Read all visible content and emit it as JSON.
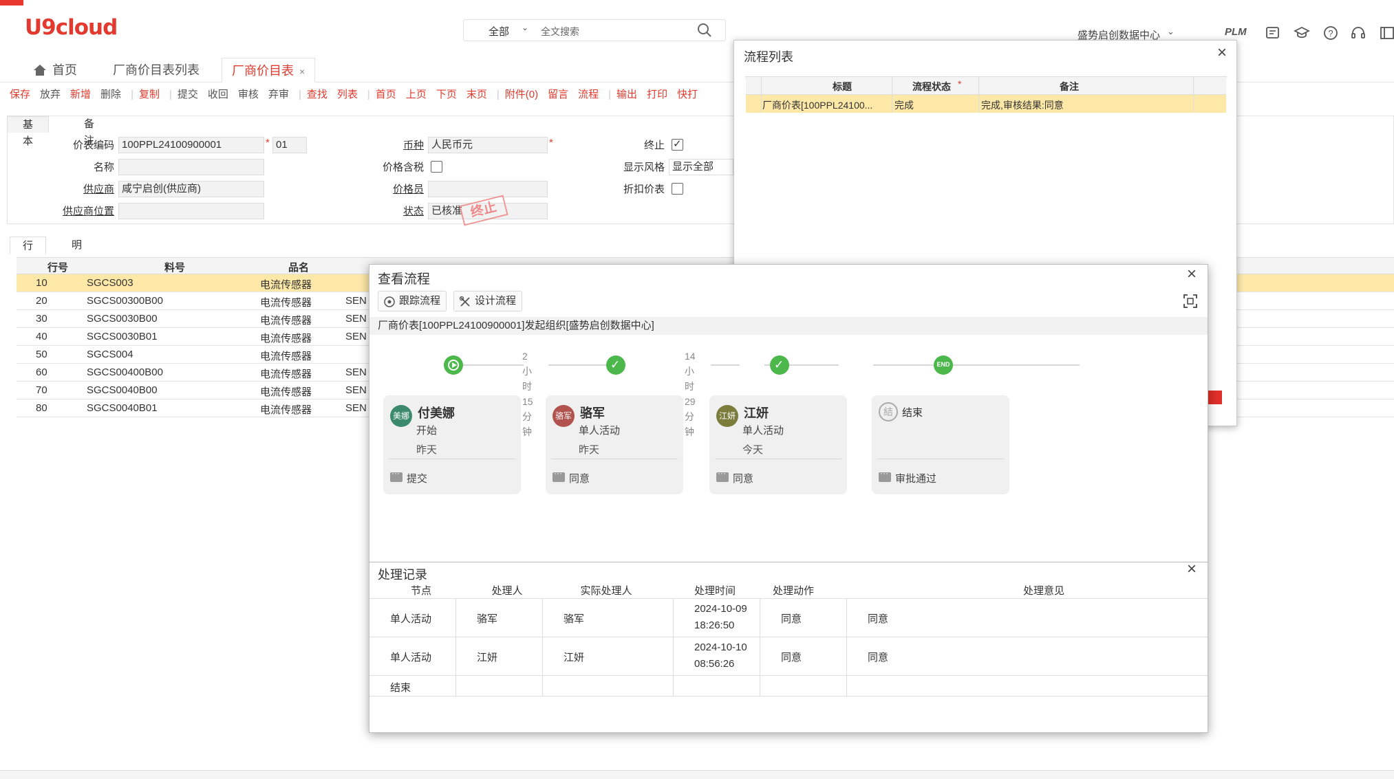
{
  "app": {
    "logo_text": "U9cloud"
  },
  "topbar": {
    "search_scope": "全部",
    "search_placeholder": "全文搜索",
    "org": "盛势启创数据中心",
    "plm": "PLM"
  },
  "page_tabs": [
    {
      "label": "首页"
    },
    {
      "label": "厂商价目表列表"
    },
    {
      "label": "厂商价目表"
    }
  ],
  "toolbar": {
    "save": "保存",
    "discard": "放弃",
    "new": "新增",
    "delete": "删除",
    "copy": "复制",
    "submit": "提交",
    "withdraw": "收回",
    "approve": "审核",
    "unapprove": "弃审",
    "find": "查找",
    "list": "列表",
    "first": "首页",
    "prev": "上页",
    "next": "下页",
    "last": "末页",
    "attach": "附件(0)",
    "message": "留言",
    "flow": "流程",
    "export": "输出",
    "print": "打印",
    "quickprint": "快打"
  },
  "form": {
    "tabs": [
      "基本",
      "备注"
    ],
    "code_label": "价表编码",
    "code_value": "100PPL24100900001",
    "version": "01",
    "name_label": "名称",
    "name_value": "",
    "supplier_label": "供应商",
    "supplier_value": "咸宁启创(供应商)",
    "supplier_loc_label": "供应商位置",
    "supplier_loc_value": "",
    "currency_label": "币种",
    "currency_value": "人民币元",
    "taxincl_label": "价格含税",
    "pricer_label": "价格员",
    "pricer_value": "",
    "status_label": "状态",
    "status_value": "已核准",
    "terminate_label": "终止",
    "style_label": "显示风格",
    "style_value": "显示全部",
    "discount_label": "折扣价表",
    "stamp": "终止"
  },
  "grid": {
    "tabs": [
      "行",
      "明细"
    ],
    "headers": [
      "行号",
      "料号",
      "品名"
    ],
    "rows": [
      {
        "no": "10",
        "part": "SGCS003",
        "name": "电流传感器",
        "extra": ""
      },
      {
        "no": "20",
        "part": "SGCS00300B00",
        "name": "电流传感器",
        "extra": "SEN"
      },
      {
        "no": "30",
        "part": "SGCS0030B00",
        "name": "电流传感器",
        "extra": "SEN"
      },
      {
        "no": "40",
        "part": "SGCS0030B01",
        "name": "电流传感器",
        "extra": "SEN"
      },
      {
        "no": "50",
        "part": "SGCS004",
        "name": "电流传感器",
        "extra": ""
      },
      {
        "no": "60",
        "part": "SGCS00400B00",
        "name": "电流传感器",
        "extra": "SEN"
      },
      {
        "no": "70",
        "part": "SGCS0040B00",
        "name": "电流传感器",
        "extra": "SEN"
      },
      {
        "no": "80",
        "part": "SGCS0040B01",
        "name": "电流传感器",
        "extra": "SEN"
      }
    ]
  },
  "process_list": {
    "title": "流程列表",
    "headers": [
      "标题",
      "流程状态",
      "备注"
    ],
    "row": {
      "title": "厂商价表[100PPL24100...",
      "status": "完成",
      "remark": "完成,审核结果:同意"
    }
  },
  "view_process": {
    "title": "查看流程",
    "track_btn": "跟踪流程",
    "design_btn": "设计流程",
    "info": "厂商价表[100PPL24100900001]发起组织[盛势启创数据中心]",
    "durations": [
      "2小时15分钟",
      "14小时29分钟"
    ],
    "end_badge": "END",
    "nodes": [
      {
        "avatar": "美娜",
        "name": "付美娜",
        "activity": "开始",
        "when": "昨天",
        "comment": "提交",
        "color": "#3c8a6e"
      },
      {
        "avatar": "骆军",
        "name": "骆军",
        "activity": "单人活动",
        "when": "昨天",
        "comment": "同意",
        "color": "#b2524f"
      },
      {
        "avatar": "江妍",
        "name": "江妍",
        "activity": "单人活动",
        "when": "今天",
        "comment": "同意",
        "color": "#7c7c3c"
      },
      {
        "avatar": "",
        "name": "结束",
        "activity": "",
        "when": "",
        "comment": "审批通过",
        "color": "#999999"
      }
    ]
  },
  "records": {
    "title": "处理记录",
    "headers": [
      "节点",
      "处理人",
      "实际处理人",
      "处理时间",
      "处理动作",
      "处理意见"
    ],
    "rows": [
      {
        "node": "单人活动",
        "handler": "骆军",
        "actual": "骆军",
        "date": "2024-10-09",
        "time": "18:26:50",
        "action": "同意",
        "opinion": "同意"
      },
      {
        "node": "单人活动",
        "handler": "江妍",
        "actual": "江妍",
        "date": "2024-10-10",
        "time": "08:56:26",
        "action": "同意",
        "opinion": "同意"
      },
      {
        "node": "结束",
        "handler": "",
        "actual": "",
        "date": "",
        "time": "",
        "action": "",
        "opinion": ""
      }
    ]
  }
}
